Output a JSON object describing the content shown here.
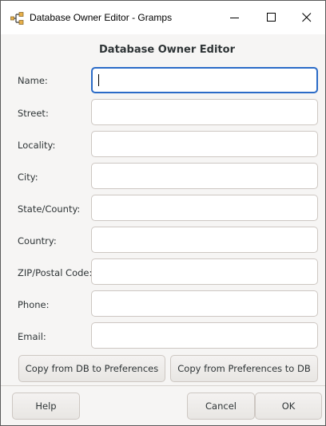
{
  "window": {
    "title": "Database Owner Editor - Gramps",
    "controls": [
      "minimize-icon",
      "maximize-icon",
      "close-icon"
    ]
  },
  "dialog": {
    "heading": "Database Owner Editor"
  },
  "fields": [
    {
      "label": "Name:",
      "value": "",
      "focused": true
    },
    {
      "label": "Street:",
      "value": ""
    },
    {
      "label": "Locality:",
      "value": ""
    },
    {
      "label": "City:",
      "value": ""
    },
    {
      "label": "State/County:",
      "value": ""
    },
    {
      "label": "Country:",
      "value": ""
    },
    {
      "label": "ZIP/Postal Code:",
      "value": ""
    },
    {
      "label": "Phone:",
      "value": ""
    },
    {
      "label": "Email:",
      "value": ""
    }
  ],
  "actions": {
    "copy_db_to_prefs": "Copy from DB to Preferences",
    "copy_prefs_to_db": "Copy from Preferences to DB"
  },
  "buttons": {
    "help": "Help",
    "cancel": "Cancel",
    "ok": "OK"
  },
  "colors": {
    "focus_border": "#2b6bc7",
    "input_border": "#cdc7c2",
    "dialog_background": "#f6f5f4"
  }
}
